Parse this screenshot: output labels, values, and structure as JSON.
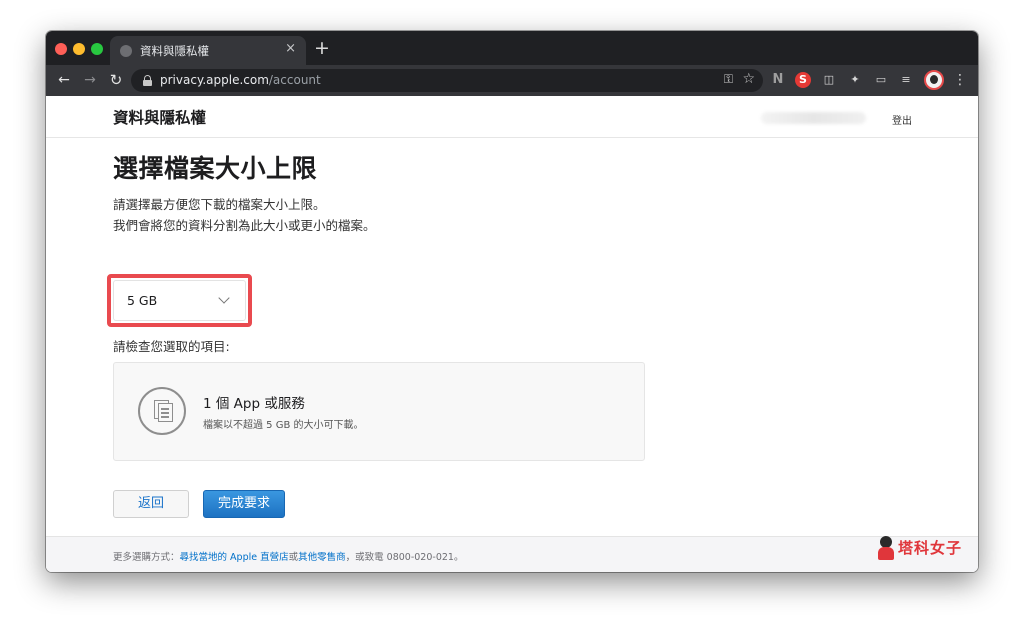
{
  "browser": {
    "tab_title": "資料與隱私權",
    "tab_close": "×",
    "new_tab": "+",
    "url_host": "privacy.apple.com",
    "url_path": "/account",
    "nav_back": "←",
    "nav_forward": "→",
    "nav_reload": "↻",
    "key_icon": "⚿",
    "star_icon": "☆",
    "ext_n": "N",
    "ext_s": "S",
    "ext_pocket": "◫",
    "ext_puzzle": "✦",
    "ext_cast": "▭",
    "ext_playlist": "≡",
    "menu": "⋮"
  },
  "header": {
    "site_title": "資料與隱私權",
    "signout": "登出"
  },
  "main": {
    "heading": "選擇檔案大小上限",
    "desc_line1": "請選擇最方便您下載的檔案大小上限。",
    "desc_line2": "我們會將您的資料分割為此大小或更小的檔案。",
    "size_select_value": "5 GB",
    "review_label": "請檢查您選取的項目:",
    "card_title": "1 個 App 或服務",
    "card_subtitle": "檔案以不超過 5 GB 的大小可下載。",
    "back_button": "返回",
    "done_button": "完成要求"
  },
  "footer": {
    "prefix": "更多選購方式：",
    "link_store": "尋找當地的 Apple 直營店",
    "or": "或",
    "link_reseller": "其他零售商",
    "suffix": "，或致電 0800-020-021。"
  },
  "watermark": {
    "text": "塔科女子"
  },
  "colors": {
    "highlight": "#e94a4f",
    "link": "#0070c9",
    "primary_button": "#1d72c2"
  }
}
